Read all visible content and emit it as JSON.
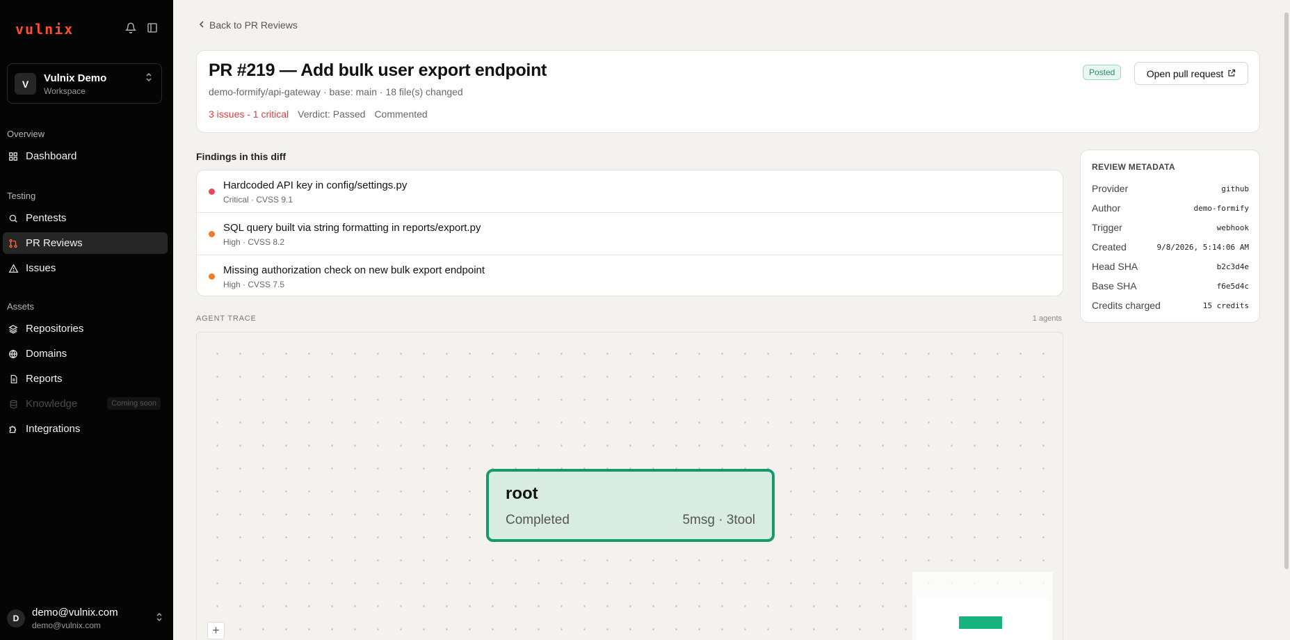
{
  "app": {
    "logo": "vulnix"
  },
  "workspace": {
    "initial": "V",
    "name": "Vulnix Demo",
    "subtitle": "Workspace"
  },
  "sidebar": {
    "sections": [
      {
        "label": "Overview",
        "items": [
          {
            "label": "Dashboard",
            "icon": "grid-icon"
          }
        ]
      },
      {
        "label": "Testing",
        "items": [
          {
            "label": "Pentests",
            "icon": "search-icon"
          },
          {
            "label": "PR Reviews",
            "icon": "git-pull-request-icon",
            "active": true
          },
          {
            "label": "Issues",
            "icon": "warning-triangle-icon"
          }
        ]
      },
      {
        "label": "Assets",
        "items": [
          {
            "label": "Repositories",
            "icon": "layers-icon"
          },
          {
            "label": "Domains",
            "icon": "globe-icon"
          },
          {
            "label": "Reports",
            "icon": "document-icon"
          },
          {
            "label": "Knowledge",
            "icon": "database-icon",
            "disabled": true,
            "badge": "Coming soon"
          },
          {
            "label": "Integrations",
            "icon": "puzzle-icon"
          }
        ]
      }
    ]
  },
  "user": {
    "initial": "D",
    "name": "demo@vulnix.com",
    "email": "demo@vulnix.com"
  },
  "back_link": "Back to PR Reviews",
  "pr": {
    "title": "PR #219 — Add bulk user export endpoint",
    "meta": "demo-formify/api-gateway · base: main · 18 file(s) changed",
    "issues_summary": "3 issues - 1 critical",
    "verdict": "Verdict: Passed",
    "comment_status": "Commented",
    "status_badge": "Posted",
    "open_button": "Open pull request"
  },
  "findings": {
    "heading": "Findings in this diff",
    "items": [
      {
        "title": "Hardcoded API key in config/settings.py",
        "subtitle": "Critical · CVSS 9.1",
        "severity_color": "#e8475f"
      },
      {
        "title": "SQL query built via string formatting in reports/export.py",
        "subtitle": "High · CVSS 8.2",
        "severity_color": "#f07c2a"
      },
      {
        "title": "Missing authorization check on new bulk export endpoint",
        "subtitle": "High · CVSS 7.5",
        "severity_color": "#f07c2a"
      }
    ]
  },
  "metadata": {
    "heading": "REVIEW METADATA",
    "rows": [
      {
        "key": "Provider",
        "value": "github"
      },
      {
        "key": "Author",
        "value": "demo-formify"
      },
      {
        "key": "Trigger",
        "value": "webhook"
      },
      {
        "key": "Created",
        "value": "9/8/2026, 5:14:06 AM"
      },
      {
        "key": "Head SHA",
        "value": "b2c3d4e"
      },
      {
        "key": "Base SHA",
        "value": "f6e5d4c"
      },
      {
        "key": "Credits charged",
        "value": "15 credits"
      }
    ]
  },
  "trace": {
    "label": "AGENT TRACE",
    "count": "1 agents",
    "node": {
      "title": "root",
      "status": "Completed",
      "stats": "5msg · 3tool"
    },
    "zoom_in": "+"
  },
  "colors": {
    "accent": "#ff4d2e",
    "node_border": "#149a6e",
    "node_fill": "#d9ece2",
    "critical": "#e8475f",
    "high": "#f07c2a"
  }
}
